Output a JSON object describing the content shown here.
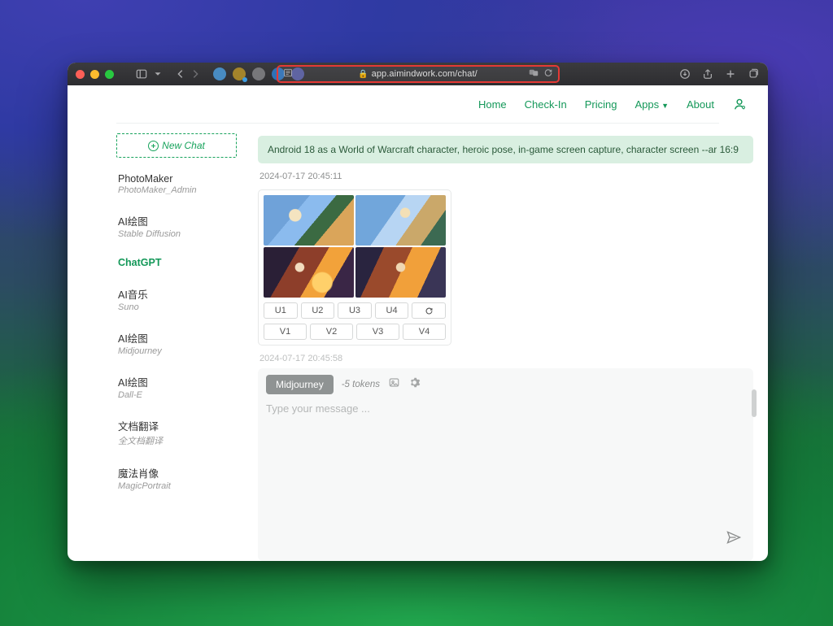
{
  "browser": {
    "url": "app.aimindwork.com/chat/"
  },
  "header": {
    "nav": [
      "Home",
      "Check-In",
      "Pricing",
      "Apps",
      "About"
    ]
  },
  "sidebar": {
    "newchat_label": "New Chat",
    "items": [
      {
        "title": "PhotoMaker",
        "sub": "PhotoMaker_Admin",
        "active": false
      },
      {
        "title": "AI绘图",
        "sub": "Stable Diffusion",
        "active": false
      },
      {
        "title": "ChatGPT",
        "sub": "",
        "active": true
      },
      {
        "title": "AI音乐",
        "sub": "Suno",
        "active": false
      },
      {
        "title": "AI绘图",
        "sub": "Midjourney",
        "active": false
      },
      {
        "title": "AI绘图",
        "sub": "Dall-E",
        "active": false
      },
      {
        "title": "文档翻译",
        "sub": "全文档翻译",
        "active": false
      },
      {
        "title": "魔法肖像",
        "sub": "MagicPortrait",
        "active": false
      }
    ]
  },
  "chat": {
    "prompt": "Android 18 as a World of Warcraft character, heroic pose, in-game screen capture, character screen --ar 16:9",
    "timestamp1": "2024-07-17 20:45:11",
    "u_buttons": [
      "U1",
      "U2",
      "U3",
      "U4"
    ],
    "v_buttons": [
      "V1",
      "V2",
      "V3",
      "V4"
    ],
    "timestamp2": "2024-07-17 20:45:58"
  },
  "composer": {
    "model": "Midjourney",
    "tokens": "-5 tokens",
    "placeholder": "Type your message ..."
  }
}
